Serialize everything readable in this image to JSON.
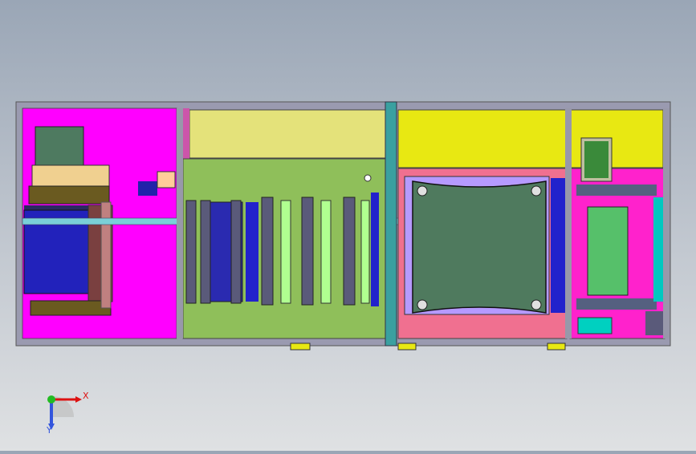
{
  "viewport": {
    "background_top": "#9aa6b6",
    "background_bottom": "#dfe1e3"
  },
  "model": {
    "frame_color": "#8a8aa0",
    "module_left_color": "#ff00ff",
    "module_mid_color": "#8fbf5a",
    "module_yellow_color": "#e4e27a",
    "module_right_yellow": "#e8e812",
    "plate_color": "#4f7a5e",
    "motor_blue": "#1c1ccc",
    "tank_green": "#56c06a",
    "cyan_rail": "#00c8c0"
  },
  "triad": {
    "x_label": "X",
    "y_label": "Y",
    "x_color": "#dd1111",
    "y_color": "#3355dd",
    "origin_color": "#22bb22"
  }
}
